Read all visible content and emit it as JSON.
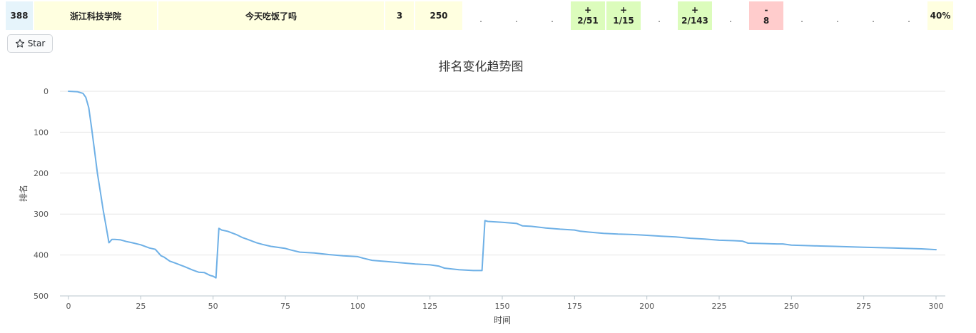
{
  "row": {
    "rank": "388",
    "school": "浙江科技学院",
    "team": "今天吃饭了吗",
    "solved": "3",
    "penalty": "250",
    "problems": [
      {
        "line1": "",
        "line2": ".",
        "status": "none"
      },
      {
        "line1": "",
        "line2": ".",
        "status": "none"
      },
      {
        "line1": "",
        "line2": ".",
        "status": "none"
      },
      {
        "line1": "+",
        "line2": "2/51",
        "status": "solved"
      },
      {
        "line1": "+",
        "line2": "1/15",
        "status": "solved"
      },
      {
        "line1": "",
        "line2": ".",
        "status": "none"
      },
      {
        "line1": "+",
        "line2": "2/143",
        "status": "solved"
      },
      {
        "line1": "",
        "line2": ".",
        "status": "none"
      },
      {
        "line1": "-",
        "line2": "8",
        "status": "failed"
      },
      {
        "line1": "",
        "line2": ".",
        "status": "none"
      },
      {
        "line1": "",
        "line2": ".",
        "status": "none"
      },
      {
        "line1": "",
        "line2": ".",
        "status": "none"
      },
      {
        "line1": "",
        "line2": ".",
        "status": "none"
      }
    ],
    "percent": "40%",
    "colors": {
      "rank_bg": "#e6f4fb",
      "school_bg": "#ffffe0",
      "solved_bg": "#dcfcbc",
      "failed_bg": "#ffcccc",
      "percent_bg": "#ffffe0"
    }
  },
  "star_button": {
    "label": "Star",
    "icon": "star-outline-icon"
  },
  "chart_data": {
    "type": "line",
    "title": "排名变化趋势图",
    "xlabel": "时间",
    "ylabel": "排名",
    "xlim": [
      0,
      300
    ],
    "ylim": [
      0,
      500
    ],
    "y_inverted": true,
    "x_ticks": [
      0,
      25,
      50,
      75,
      100,
      125,
      150,
      175,
      200,
      225,
      250,
      275,
      300
    ],
    "y_ticks": [
      0,
      100,
      200,
      300,
      400,
      500
    ],
    "grid": "horizontal",
    "line_color": "#6eb0e6",
    "series": [
      {
        "x": [
          0,
          3,
          5,
          6,
          7,
          8,
          9,
          10,
          11,
          12,
          13,
          14,
          15,
          16,
          18,
          20,
          22,
          25,
          28,
          30,
          32,
          33,
          35,
          37,
          40,
          43,
          45,
          47,
          49,
          50,
          51,
          52,
          53,
          55,
          58,
          60,
          62,
          65,
          67,
          70,
          75,
          77,
          80,
          85,
          90,
          95,
          100,
          102,
          105,
          110,
          115,
          120,
          125,
          128,
          130,
          135,
          140,
          143,
          144,
          145,
          150,
          155,
          157,
          160,
          165,
          170,
          175,
          177,
          180,
          185,
          190,
          195,
          200,
          205,
          210,
          215,
          220,
          225,
          230,
          233,
          235,
          240,
          245,
          247,
          250,
          255,
          260,
          265,
          270,
          275,
          280,
          285,
          290,
          295,
          300
        ],
        "y": [
          0,
          1,
          5,
          15,
          40,
          90,
          145,
          200,
          245,
          290,
          330,
          370,
          362,
          362,
          363,
          367,
          370,
          375,
          383,
          386,
          402,
          405,
          415,
          420,
          428,
          437,
          442,
          443,
          450,
          452,
          456,
          335,
          339,
          342,
          350,
          357,
          362,
          370,
          374,
          379,
          384,
          388,
          393,
          395,
          399,
          402,
          404,
          408,
          413,
          416,
          419,
          422,
          424,
          427,
          432,
          436,
          438,
          438,
          316,
          318,
          320,
          323,
          329,
          330,
          334,
          337,
          339,
          342,
          344,
          347,
          349,
          350,
          352,
          354,
          356,
          359,
          361,
          364,
          365,
          366,
          371,
          372,
          373,
          373,
          376,
          377,
          378,
          379,
          380,
          381,
          382,
          383,
          384,
          385,
          387
        ]
      }
    ]
  }
}
